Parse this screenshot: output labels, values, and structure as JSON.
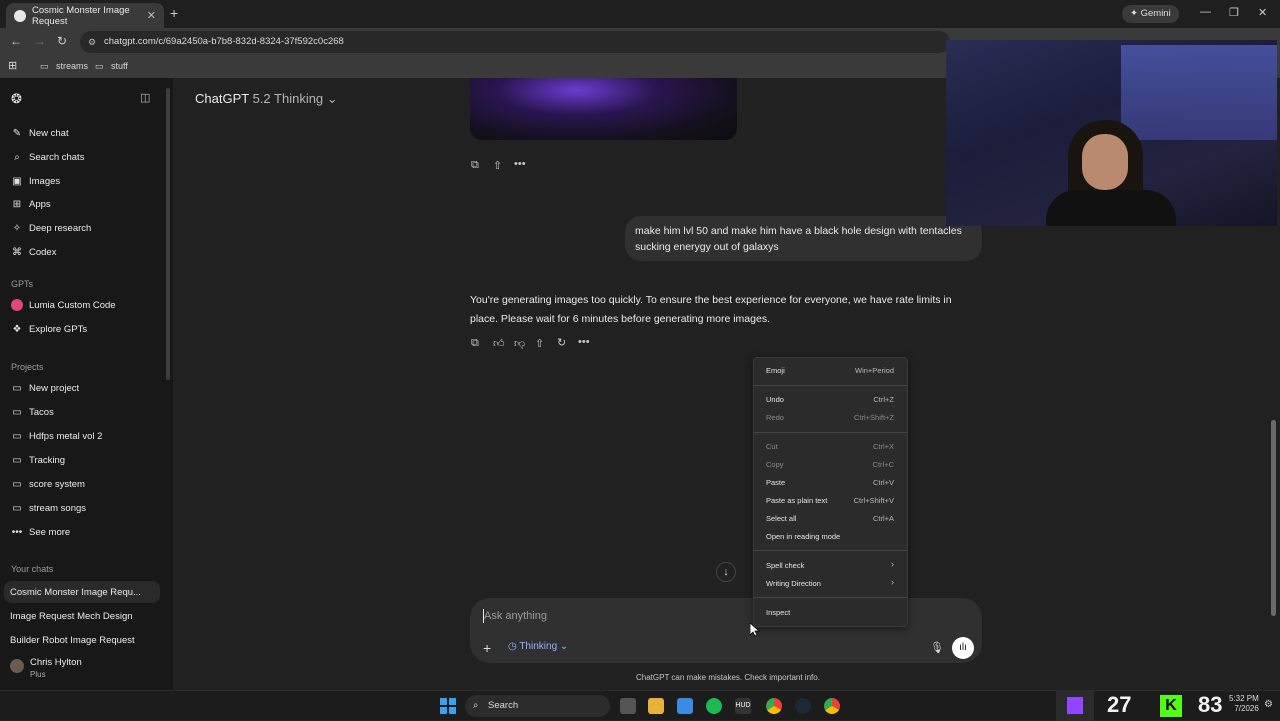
{
  "browser": {
    "tab_title": "Cosmic Monster Image Request",
    "gemini_label": "Gemini",
    "url": "chatgpt.com/c/69a2450a-b7b8-832d-8324-37f592c0c268",
    "bookmarks": [
      "streams",
      "stuff"
    ]
  },
  "sidebar": {
    "nav": [
      "New chat",
      "Search chats",
      "Images",
      "Apps",
      "Deep research",
      "Codex"
    ],
    "gpts_heading": "GPTs",
    "gpts": [
      "Lumia Custom Code",
      "Explore GPTs"
    ],
    "projects_heading": "Projects",
    "projects": [
      "New project",
      "Tacos",
      "Hdfps metal vol 2",
      "Tracking",
      "score system",
      "stream songs",
      "See more"
    ],
    "chats_heading": "Your chats",
    "chats": [
      "Cosmic Monster Image Requ...",
      "Image Request Mech Design",
      "Builder Robot Image Request"
    ],
    "user_name": "Chris Hylton",
    "user_plan": "Plus"
  },
  "header": {
    "model": "ChatGPT",
    "model_version": "5.2 Thinking"
  },
  "conversation": {
    "user_message": "make him lvl 50 and make him have a black hole design with tentacles sucking enerygy out of galaxys",
    "assistant_message": "You're generating images too quickly. To ensure the best experience for everyone, we have rate limits in place. Please wait for 6 minutes before generating more images."
  },
  "composer": {
    "placeholder": "Ask anything",
    "mode_label": "Thinking",
    "disclaimer": "ChatGPT can make mistakes. Check important info."
  },
  "context_menu": {
    "items": [
      {
        "label": "Emoji",
        "shortcut": "Win+Period",
        "enabled": true
      },
      {
        "label": "Undo",
        "shortcut": "Ctrl+Z",
        "enabled": true
      },
      {
        "label": "Redo",
        "shortcut": "Ctrl+Shift+Z",
        "enabled": false
      },
      {
        "label": "Cut",
        "shortcut": "Ctrl+X",
        "enabled": false
      },
      {
        "label": "Copy",
        "shortcut": "Ctrl+C",
        "enabled": false
      },
      {
        "label": "Paste",
        "shortcut": "Ctrl+V",
        "enabled": true
      },
      {
        "label": "Paste as plain text",
        "shortcut": "Ctrl+Shift+V",
        "enabled": true
      },
      {
        "label": "Select all",
        "shortcut": "Ctrl+A",
        "enabled": true
      },
      {
        "label": "Open in reading mode",
        "shortcut": "",
        "enabled": true
      },
      {
        "label": "Spell check",
        "shortcut": "",
        "enabled": true
      },
      {
        "label": "Writing Direction",
        "shortcut": "",
        "enabled": true
      },
      {
        "label": "Inspect",
        "shortcut": "",
        "enabled": true
      }
    ]
  },
  "taskbar": {
    "search_label": "Search",
    "counter_left": "27",
    "counter_right": "83",
    "time": "5:32 PM",
    "date": "7/2026"
  }
}
